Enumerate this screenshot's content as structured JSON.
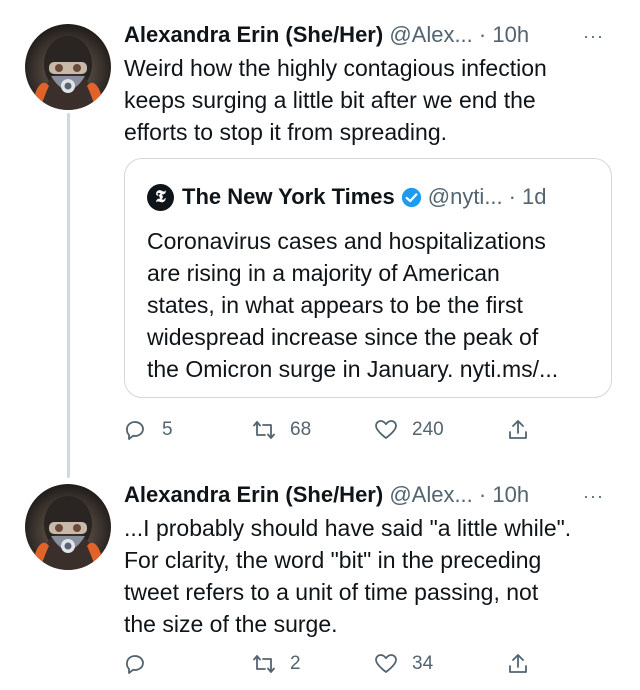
{
  "tweets": [
    {
      "name": "Alexandra Erin (She/Her)",
      "handle": "@Alex...",
      "dot": "·",
      "time": "10h",
      "more": "···",
      "text": "Weird how the highly contagious infection\nkeeps surging a little bit after we end the\nefforts to stop it from spreading.",
      "quote": {
        "logo": "𝕿",
        "name": "The New York Times",
        "handle": "@nyti...",
        "dot": "·",
        "time": "1d",
        "text": "Coronavirus cases and hospitalizations\nare rising in a majority of American\nstates, in what appears to be the first\nwidespread increase since the peak of\nthe Omicron surge in January. nyti.ms/..."
      },
      "replies": "5",
      "retweets": "68",
      "likes": "240"
    },
    {
      "name": "Alexandra Erin (She/Her)",
      "handle": "@Alex...",
      "dot": "·",
      "time": "10h",
      "more": "···",
      "text": "...I probably should have said \"a little while\".\nFor clarity, the word \"bit\" in the preceding\ntweet refers to a unit of time passing, not\nthe size of the surge.",
      "replies": "",
      "retweets": "2",
      "likes": "34"
    }
  ],
  "colors": {
    "text": "#0f1419",
    "muted": "#536471",
    "border": "#cfd9de",
    "verified": "#1d9bf0"
  },
  "icons": [
    "reply-icon",
    "retweet-icon",
    "like-icon",
    "share-icon",
    "verified-badge-icon",
    "more-icon"
  ]
}
